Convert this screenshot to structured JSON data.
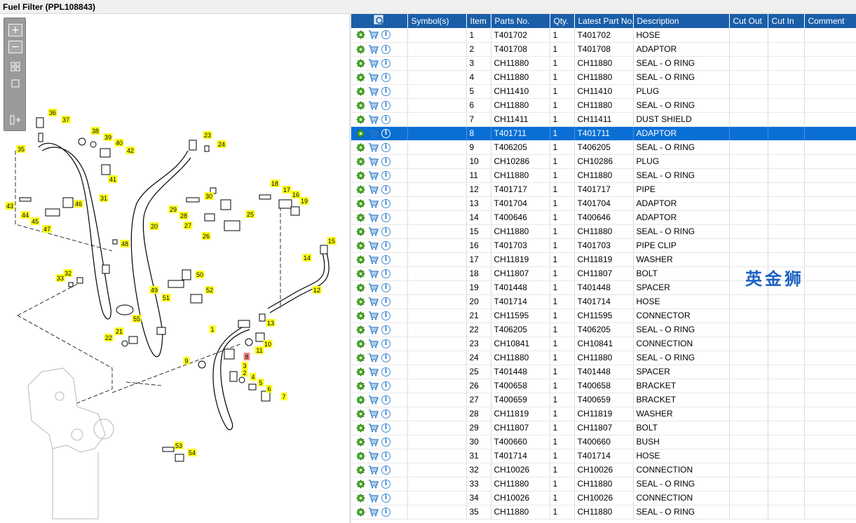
{
  "window": {
    "title": "Fuel Filter (PPL108843)"
  },
  "watermark": "英金狮",
  "colors": {
    "header_bg": "#1a5ea8",
    "selected_row": "#0a6fd4",
    "callout": "#ffff1a",
    "callout_selected": "#f28b8b"
  },
  "zoom_toolbar": {
    "zoom_in": "+",
    "zoom_out": "−",
    "fit": "fit-icon",
    "actual": "actual-size-icon",
    "panel": "panel-toggle-icon"
  },
  "table": {
    "columns": {
      "find": "",
      "symbols": "Symbol(s)",
      "item": "Item",
      "parts_no": "Parts No.",
      "qty": "Qty.",
      "latest": "Latest Part No.",
      "description": "Description",
      "cut_out": "Cut Out",
      "cut_in": "Cut In",
      "comment": "Comment"
    },
    "selected_item": "8",
    "rows": [
      {
        "item": "1",
        "part": "T401702",
        "qty": "1",
        "latest": "T401702",
        "desc": "HOSE"
      },
      {
        "item": "2",
        "part": "T401708",
        "qty": "1",
        "latest": "T401708",
        "desc": "ADAPTOR"
      },
      {
        "item": "3",
        "part": "CH11880",
        "qty": "1",
        "latest": "CH11880",
        "desc": "SEAL - O RING"
      },
      {
        "item": "4",
        "part": "CH11880",
        "qty": "1",
        "latest": "CH11880",
        "desc": "SEAL - O RING"
      },
      {
        "item": "5",
        "part": "CH11410",
        "qty": "1",
        "latest": "CH11410",
        "desc": "PLUG"
      },
      {
        "item": "6",
        "part": "CH11880",
        "qty": "1",
        "latest": "CH11880",
        "desc": "SEAL - O RING"
      },
      {
        "item": "7",
        "part": "CH11411",
        "qty": "1",
        "latest": "CH11411",
        "desc": "DUST SHIELD"
      },
      {
        "item": "8",
        "part": "T401711",
        "qty": "1",
        "latest": "T401711",
        "desc": "ADAPTOR"
      },
      {
        "item": "9",
        "part": "T406205",
        "qty": "1",
        "latest": "T406205",
        "desc": "SEAL - O RING"
      },
      {
        "item": "10",
        "part": "CH10286",
        "qty": "1",
        "latest": "CH10286",
        "desc": "PLUG"
      },
      {
        "item": "11",
        "part": "CH11880",
        "qty": "1",
        "latest": "CH11880",
        "desc": "SEAL - O RING"
      },
      {
        "item": "12",
        "part": "T401717",
        "qty": "1",
        "latest": "T401717",
        "desc": "PIPE"
      },
      {
        "item": "13",
        "part": "T401704",
        "qty": "1",
        "latest": "T401704",
        "desc": "ADAPTOR"
      },
      {
        "item": "14",
        "part": "T400646",
        "qty": "1",
        "latest": "T400646",
        "desc": "ADAPTOR"
      },
      {
        "item": "15",
        "part": "CH11880",
        "qty": "1",
        "latest": "CH11880",
        "desc": "SEAL - O RING"
      },
      {
        "item": "16",
        "part": "T401703",
        "qty": "1",
        "latest": "T401703",
        "desc": "PIPE CLIP"
      },
      {
        "item": "17",
        "part": "CH11819",
        "qty": "1",
        "latest": "CH11819",
        "desc": "WASHER"
      },
      {
        "item": "18",
        "part": "CH11807",
        "qty": "1",
        "latest": "CH11807",
        "desc": "BOLT"
      },
      {
        "item": "19",
        "part": "T401448",
        "qty": "1",
        "latest": "T401448",
        "desc": "SPACER"
      },
      {
        "item": "20",
        "part": "T401714",
        "qty": "1",
        "latest": "T401714",
        "desc": "HOSE"
      },
      {
        "item": "21",
        "part": "CH11595",
        "qty": "1",
        "latest": "CH11595",
        "desc": "CONNECTOR"
      },
      {
        "item": "22",
        "part": "T406205",
        "qty": "1",
        "latest": "T406205",
        "desc": "SEAL - O RING"
      },
      {
        "item": "23",
        "part": "CH10841",
        "qty": "1",
        "latest": "CH10841",
        "desc": "CONNECTION"
      },
      {
        "item": "24",
        "part": "CH11880",
        "qty": "1",
        "latest": "CH11880",
        "desc": "SEAL - O RING"
      },
      {
        "item": "25",
        "part": "T401448",
        "qty": "1",
        "latest": "T401448",
        "desc": "SPACER"
      },
      {
        "item": "26",
        "part": "T400658",
        "qty": "1",
        "latest": "T400658",
        "desc": "BRACKET"
      },
      {
        "item": "27",
        "part": "T400659",
        "qty": "1",
        "latest": "T400659",
        "desc": "BRACKET"
      },
      {
        "item": "28",
        "part": "CH11819",
        "qty": "1",
        "latest": "CH11819",
        "desc": "WASHER"
      },
      {
        "item": "29",
        "part": "CH11807",
        "qty": "1",
        "latest": "CH11807",
        "desc": "BOLT"
      },
      {
        "item": "30",
        "part": "T400660",
        "qty": "1",
        "latest": "T400660",
        "desc": "BUSH"
      },
      {
        "item": "31",
        "part": "T401714",
        "qty": "1",
        "latest": "T401714",
        "desc": "HOSE"
      },
      {
        "item": "32",
        "part": "CH10026",
        "qty": "1",
        "latest": "CH10026",
        "desc": "CONNECTION"
      },
      {
        "item": "33",
        "part": "CH11880",
        "qty": "1",
        "latest": "CH11880",
        "desc": "SEAL - O RING"
      },
      {
        "item": "34",
        "part": "CH10026",
        "qty": "1",
        "latest": "CH10026",
        "desc": "CONNECTION"
      },
      {
        "item": "35",
        "part": "CH11880",
        "qty": "1",
        "latest": "CH11880",
        "desc": "SEAL - O RING"
      }
    ]
  },
  "diagram": {
    "callouts": [
      "1",
      "2",
      "3",
      "4",
      "5",
      "6",
      "7",
      "8",
      "9",
      "10",
      "11",
      "12",
      "13",
      "14",
      "15",
      "16",
      "17",
      "18",
      "19",
      "20",
      "21",
      "22",
      "23",
      "24",
      "25",
      "26",
      "27",
      "28",
      "29",
      "30",
      "31",
      "32",
      "33",
      "35",
      "36",
      "37",
      "38",
      "39",
      "40",
      "41",
      "42",
      "43",
      "44",
      "45",
      "46",
      "47",
      "48",
      "49",
      "50",
      "51",
      "52",
      "53",
      "54",
      "55"
    ]
  }
}
